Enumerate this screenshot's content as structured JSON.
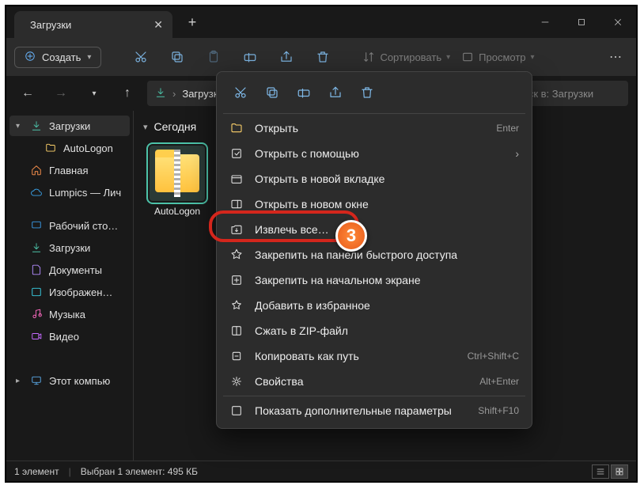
{
  "tab": {
    "title": "Загрузки"
  },
  "toolbar": {
    "create": "Создать",
    "sort": "Сортировать",
    "view": "Просмотр"
  },
  "addr": {
    "crumb": "Загрузки"
  },
  "search": {
    "placeholder": "Поиск в: Загрузки"
  },
  "sidebar": {
    "downloads": "Загрузки",
    "autologon": "AutoLogon",
    "home": "Главная",
    "lumpics": "Lumpics — Лич",
    "desktop": "Рабочий сто…",
    "downloads2": "Загрузки",
    "documents": "Документы",
    "pictures": "Изображен…",
    "music": "Музыка",
    "video": "Видео",
    "thispc": "Этот компью"
  },
  "content": {
    "group": "Сегодня",
    "file_name": "AutoLogon"
  },
  "ctx": {
    "open": "Открыть",
    "open_sc": "Enter",
    "openwith": "Открыть с помощью",
    "opennewtab": "Открыть в новой вкладке",
    "opennewwin": "Открыть в новом окне",
    "extract": "Извлечь все…",
    "pinquick": "Закрепить на панели быстрого доступа",
    "pinstart": "Закрепить на начальном экране",
    "addfav": "Добавить в избранное",
    "compress": "Сжать в ZIP-файл",
    "copypath": "Копировать как путь",
    "copypath_sc": "Ctrl+Shift+C",
    "properties": "Свойства",
    "properties_sc": "Alt+Enter",
    "showmore": "Показать дополнительные параметры",
    "showmore_sc": "Shift+F10"
  },
  "status": {
    "count": "1 элемент",
    "selection": "Выбран 1 элемент: 495 КБ"
  },
  "badge": "3"
}
